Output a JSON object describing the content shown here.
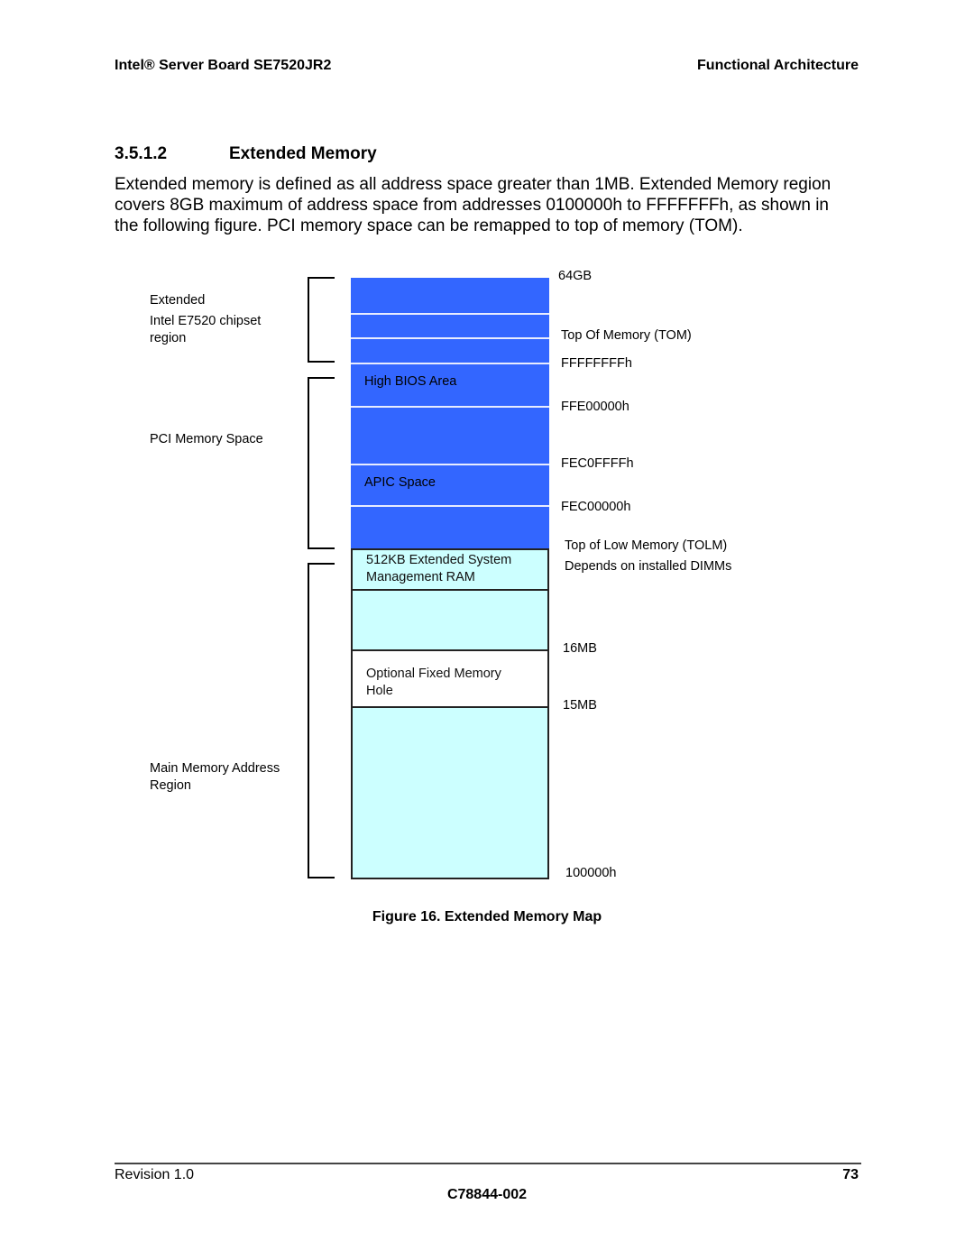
{
  "header": {
    "doc_title": "Intel® Server Board SE7520JR2",
    "chapter": "Functional Architecture"
  },
  "section": {
    "number": "3.5.1.2",
    "title": "Extended Memory",
    "paragraph_lines": [
      "Extended memory is defined as all address space greater than 1MB. Extended Memory region",
      "covers 8GB maximum of address space from addresses 0100000h to FFFFFFFh, as shown in",
      "the following figure. PCI memory space can be remapped to top of memory (TOM)."
    ]
  },
  "figure": {
    "caption": "Figure 16. Extended Memory Map",
    "colors": {
      "pci_region": "#3366ff",
      "main_memory": "#ccffff",
      "memory_hole": "#ffffff"
    },
    "region_labels": {
      "extended_l1": "Extended",
      "extended_l2": "Intel E7520 chipset",
      "extended_l3": "region",
      "pci": "PCI Memory Space",
      "main_l1": "Main Memory Address",
      "main_l2": "Region"
    },
    "blocks": {
      "high_bios": "High BIOS Area",
      "apic": "APIC Space",
      "smram_l1": "512KB Extended System",
      "smram_l2": "Management RAM",
      "hole_l1": "Optional Fixed Memory",
      "hole_l2": "Hole"
    },
    "address_labels": {
      "a64gb": "64GB",
      "tom": "Top Of Memory (TOM)",
      "ffffffff": "FFFFFFFFh",
      "ffe00000": "FFE00000h",
      "fec0ffff": "FEC0FFFFh",
      "fec00000": "FEC00000h",
      "tolm_l1": "Top of Low Memory (TOLM)",
      "tolm_l2": "Depends on installed DIMMs",
      "m16": "16MB",
      "m15": "15MB",
      "base": "100000h"
    }
  },
  "footer": {
    "revision": "Revision 1.0",
    "page": "73",
    "doc_number": "C78844-002"
  }
}
